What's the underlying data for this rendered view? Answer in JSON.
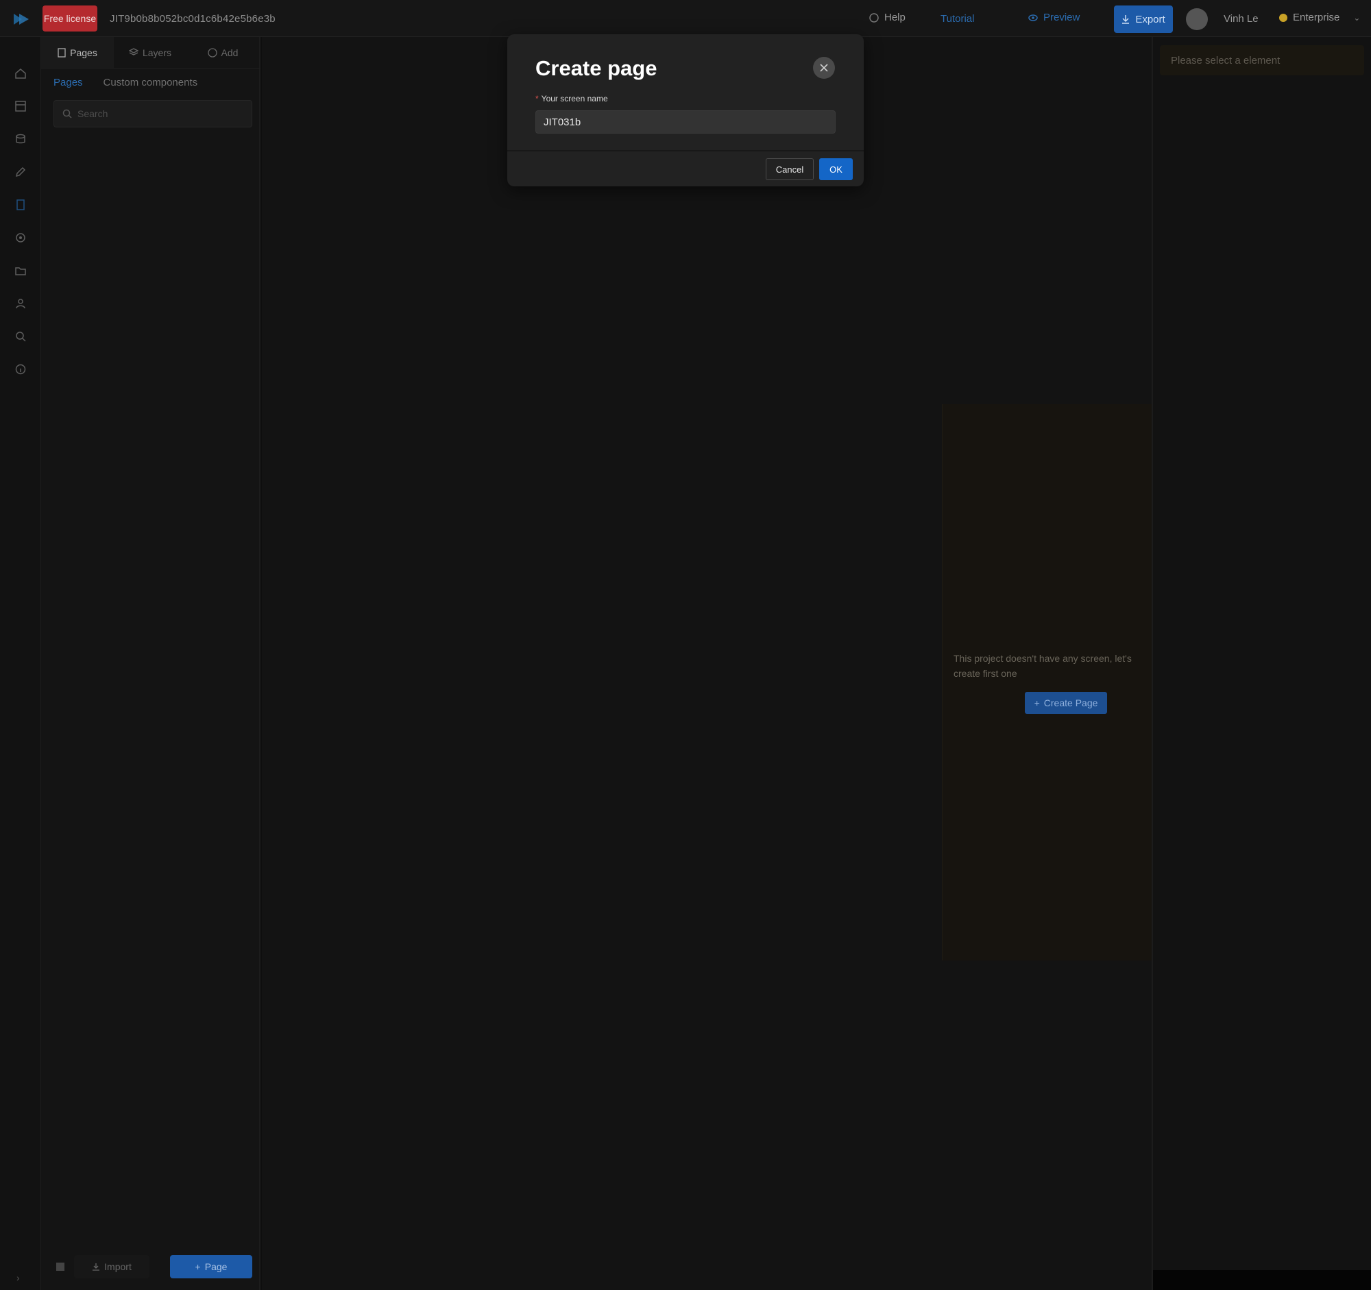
{
  "topbar": {
    "plan_badge": "Free license",
    "project_id": "JIT9b0b8b052bc0d1c6b42e5b6e3b",
    "help_label": "Help",
    "tutorial_label": "Tutorial",
    "preview_label": "Preview",
    "export_label": "Export",
    "user_name": "Vinh Le",
    "plan_label": "Enterprise"
  },
  "rail": {
    "icons": [
      "home-icon",
      "layout-icon",
      "database-icon",
      "pen-icon",
      "page-icon",
      "settings-icon",
      "folder-icon",
      "user-icon",
      "search-icon",
      "info-icon"
    ]
  },
  "sidepanel": {
    "tabs": [
      {
        "label": "Pages",
        "icon": "page-icon"
      },
      {
        "label": "Layers",
        "icon": "layers-icon"
      },
      {
        "label": "Add",
        "icon": "add-icon"
      }
    ],
    "subtabs": [
      "Pages",
      "Custom components"
    ],
    "search_placeholder": "Search",
    "import_label": "Import",
    "add_page_label": "Page"
  },
  "canvas": {
    "empty_message": "This project doesn't have any screen, let's create first one",
    "create_page_label": "Create Page"
  },
  "rightpanel": {
    "alert_text": "Please select a element"
  },
  "modal": {
    "title": "Create page",
    "field_label": "Your screen name",
    "field_required_mark": "*",
    "field_value": "JIT031b",
    "cancel_label": "Cancel",
    "ok_label": "OK"
  },
  "colors": {
    "accent": "#1466c7",
    "danger": "#b52a2f",
    "modal_bg": "#222222",
    "overlay_bg": "#0e0e0e"
  }
}
